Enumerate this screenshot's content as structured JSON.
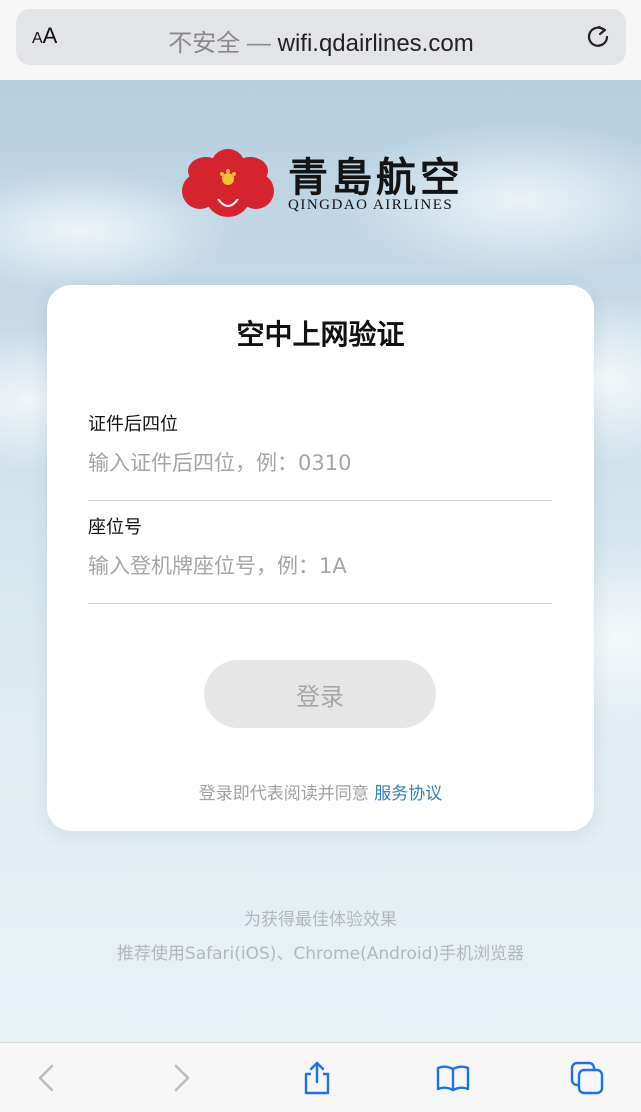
{
  "browser": {
    "text_size_label": "AA",
    "insecure_label": "不安全 — ",
    "domain": "wifi.qdairlines.com"
  },
  "brand": {
    "name_cn": "青島航空",
    "name_en": "QINGDAO AIRLINES",
    "accent": "#d6242e"
  },
  "card": {
    "title": "空中上网验证",
    "id_label": "证件后四位",
    "id_placeholder": "输入证件后四位，例：0310",
    "id_value": "",
    "seat_label": "座位号",
    "seat_placeholder": "输入登机牌座位号，例：1A",
    "seat_value": "",
    "login_label": "登录",
    "agree_text": "登录即代表阅读并同意 ",
    "agree_link": "服务协议"
  },
  "tips": {
    "line1": "为获得最佳体验效果",
    "line2": "推荐使用Safari(iOS)、Chrome(Android)手机浏览器"
  },
  "toolbar": {
    "icons": [
      "back-icon",
      "forward-icon",
      "share-icon",
      "bookmarks-icon",
      "tabs-icon"
    ]
  }
}
